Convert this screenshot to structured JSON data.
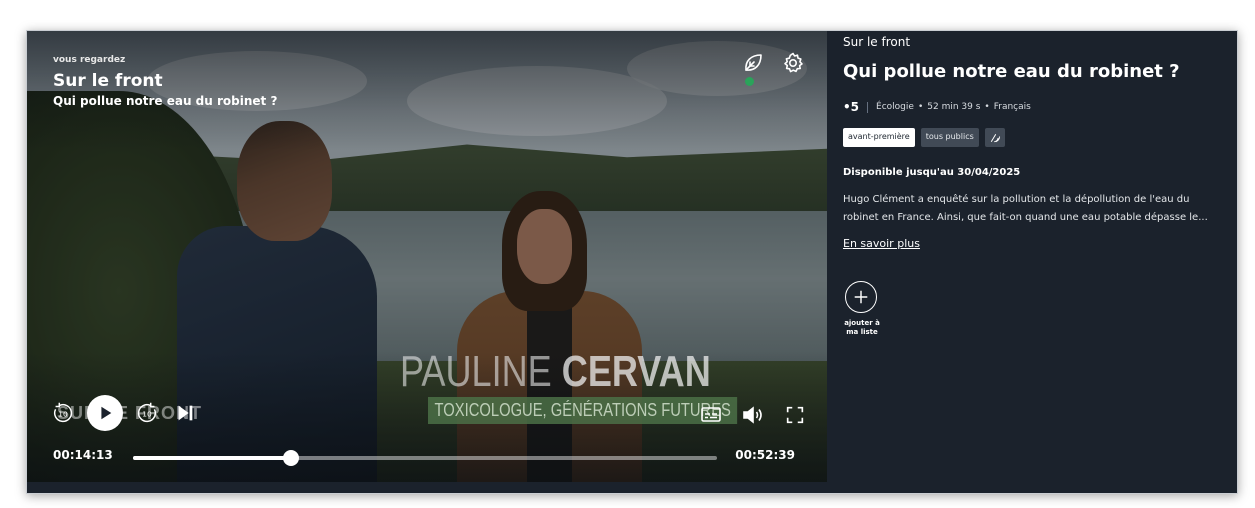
{
  "player": {
    "now_watching_label": "vous regardez",
    "show_title": "Sur le front",
    "episode_title": "Qui pollue notre eau du robinet ?",
    "lower_third_first": "PAULINE",
    "lower_third_last": "CERVAN",
    "lower_third_role": "TOXICOLOGUE, GÉNÉRATIONS FUTURES",
    "watermark": "SUR LE FRONT",
    "current_time": "00:14:13",
    "total_time": "00:52:39",
    "progress_fraction": 0.27,
    "replay_seconds": "10",
    "forward_seconds": "10"
  },
  "info": {
    "show_title": "Sur le front",
    "episode_title": "Qui pollue notre eau du robinet ?",
    "rating": "•5",
    "genre": "Écologie",
    "duration": "52 min 39 s",
    "language": "Français",
    "tags": [
      "avant-première",
      "tous publics"
    ],
    "availability": "Disponible jusqu'au 30/04/2025",
    "description_line1": "Hugo Clément a enquêté sur la pollution et la dépollution de l'eau du",
    "description_line2": "robinet en France. Ainsi, que fait-on quand une eau potable dépasse le...",
    "more_link": "En savoir plus",
    "add_label_line1": "ajouter à",
    "add_label_line2": "ma liste"
  },
  "icons": {
    "eco": "leaf-icon",
    "settings": "gear-icon",
    "replay": "replay-10-icon",
    "play": "play-icon",
    "forward": "forward-10-icon",
    "next": "skip-next-icon",
    "subtitles": "subtitles-icon",
    "volume": "volume-icon",
    "fullscreen": "fullscreen-icon",
    "audio_description": "audio-description-icon",
    "add": "plus-icon"
  },
  "colors": {
    "panel_bg": "#1b222c",
    "accent_green": "#2aa35a",
    "lower_third_green": "#4b7046"
  }
}
